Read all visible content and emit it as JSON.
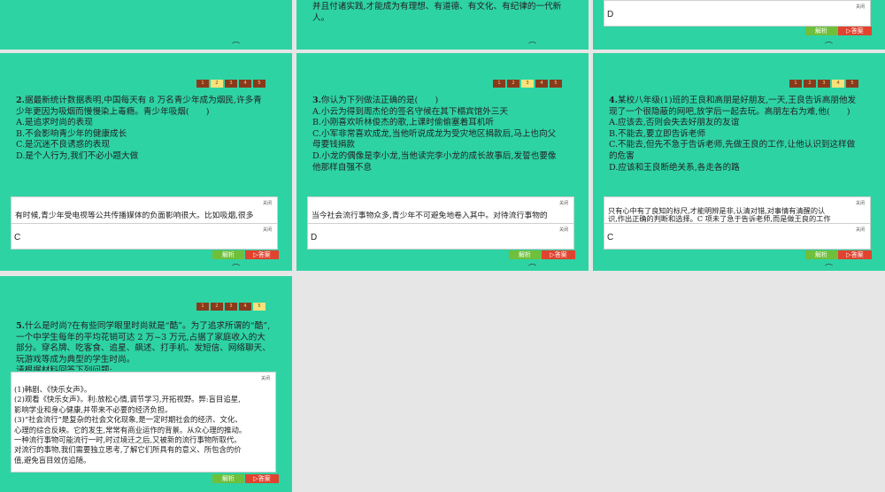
{
  "nav_numbers": [
    "1",
    "2",
    "3",
    "4",
    "5"
  ],
  "close_label": "关闭",
  "explain_label": "解析",
  "answer_label": "答案",
  "top_slides": {
    "middle_text": "并且付诸实践,才能成为有理想、有道德、有文化、有纪律的一代新人。",
    "right_answer": "D"
  },
  "slide2": {
    "number": "2.",
    "lines": [
      "据最新统计数据表明,中国每天有 8 万名青少年成为烟民,许多青",
      "少年更因为吸烟而慢慢染上毒瘾。青少年吸烟(　　)"
    ],
    "options": [
      "A.是追求时尚的表现",
      "B.不会影响青少年的健康成长",
      "C.是沉迷不良诱惑的表现",
      "D.是个人行为,我们不必小题大做"
    ],
    "explanation": "有时候,青少年受电视等公共传播媒体的负面影响很大。比如吸烟,很多",
    "answer": "C"
  },
  "slide3": {
    "number": "3.",
    "lines": [
      "你认为下列做法正确的是(　　)"
    ],
    "options": [
      "A.小云为得到周杰伦的签名守候在其下榻宾馆外三天",
      "B.小刚喜欢听林俊杰的歌,上课时偷偷塞着耳机听",
      "C.小军非常喜欢成龙,当他听说成龙为受灾地区捐款后,马上也向父",
      "母要钱捐款",
      "D.小龙的偶像是李小龙,当他读完李小龙的成长故事后,发誓也要像",
      "他那样自强不息"
    ],
    "explanation": "当今社会流行事物众多,青少年不可避免地卷入其中。对待流行事物的",
    "answer": "D"
  },
  "slide4": {
    "number": "4.",
    "lines": [
      "某校八年级(1)班的王良和高朋是好朋友,一天,王良告诉高朋他发",
      "现了一个很隐蔽的网吧,放学后一起去玩。高朋左右为难,他(　　)"
    ],
    "options": [
      "A.应该去,否则会失去好朋友的友谊",
      "B.不能去,要立即告诉老师",
      "C.不能去,但先不急于告诉老师,先做王良的工作,让他认识到这样做",
      "的危害",
      "D.应该和王良断绝关系,各走各的路"
    ],
    "explanation_lines": [
      "只有心中有了良知的标尺,才能明辨是非,认清对错,对事情有清醒的认",
      "识,作出正确的判断和选择。C 项未了急于告诉老师,而是做王良的工作"
    ],
    "answer": "C"
  },
  "slide5": {
    "number": "5.",
    "lines": [
      "什么是时尚?在有些同学眼里时尚就是“酷”。为了追求所谓的“酷”,",
      "一个中学生每年的平均花销可达 2 万~3 万元,占据了家庭收入的大",
      "部分。穿名牌、吃客食、追星、飙述、打手机、发短信、网络聊天、",
      "玩游戏等成为典型的学生时尚。",
      "请根据材料回答下列问题:"
    ],
    "answer_lines": [
      "(1)韩剧、《快乐女声》。",
      "(2)观看《快乐女声》。利:放松心情,调节学习,开拓视野。弊:盲目追星,",
      "影响学业和身心健康,并带来不必要的经济负担。",
      "(3)“社会流行”是复杂的社会文化现象,是一定时期社会的经济、文化、",
      "心理的综合反映。它的发生,常常有商业运作的背景。从众心理的推动。",
      "一种流行事物可能流行一时,时过境迁之后,又被新的流行事物所取代。",
      "对流行的事物,我们需要独立思考,了解它们所具有的意义、所包含的价",
      "值,避免盲目效仿追随。"
    ]
  }
}
